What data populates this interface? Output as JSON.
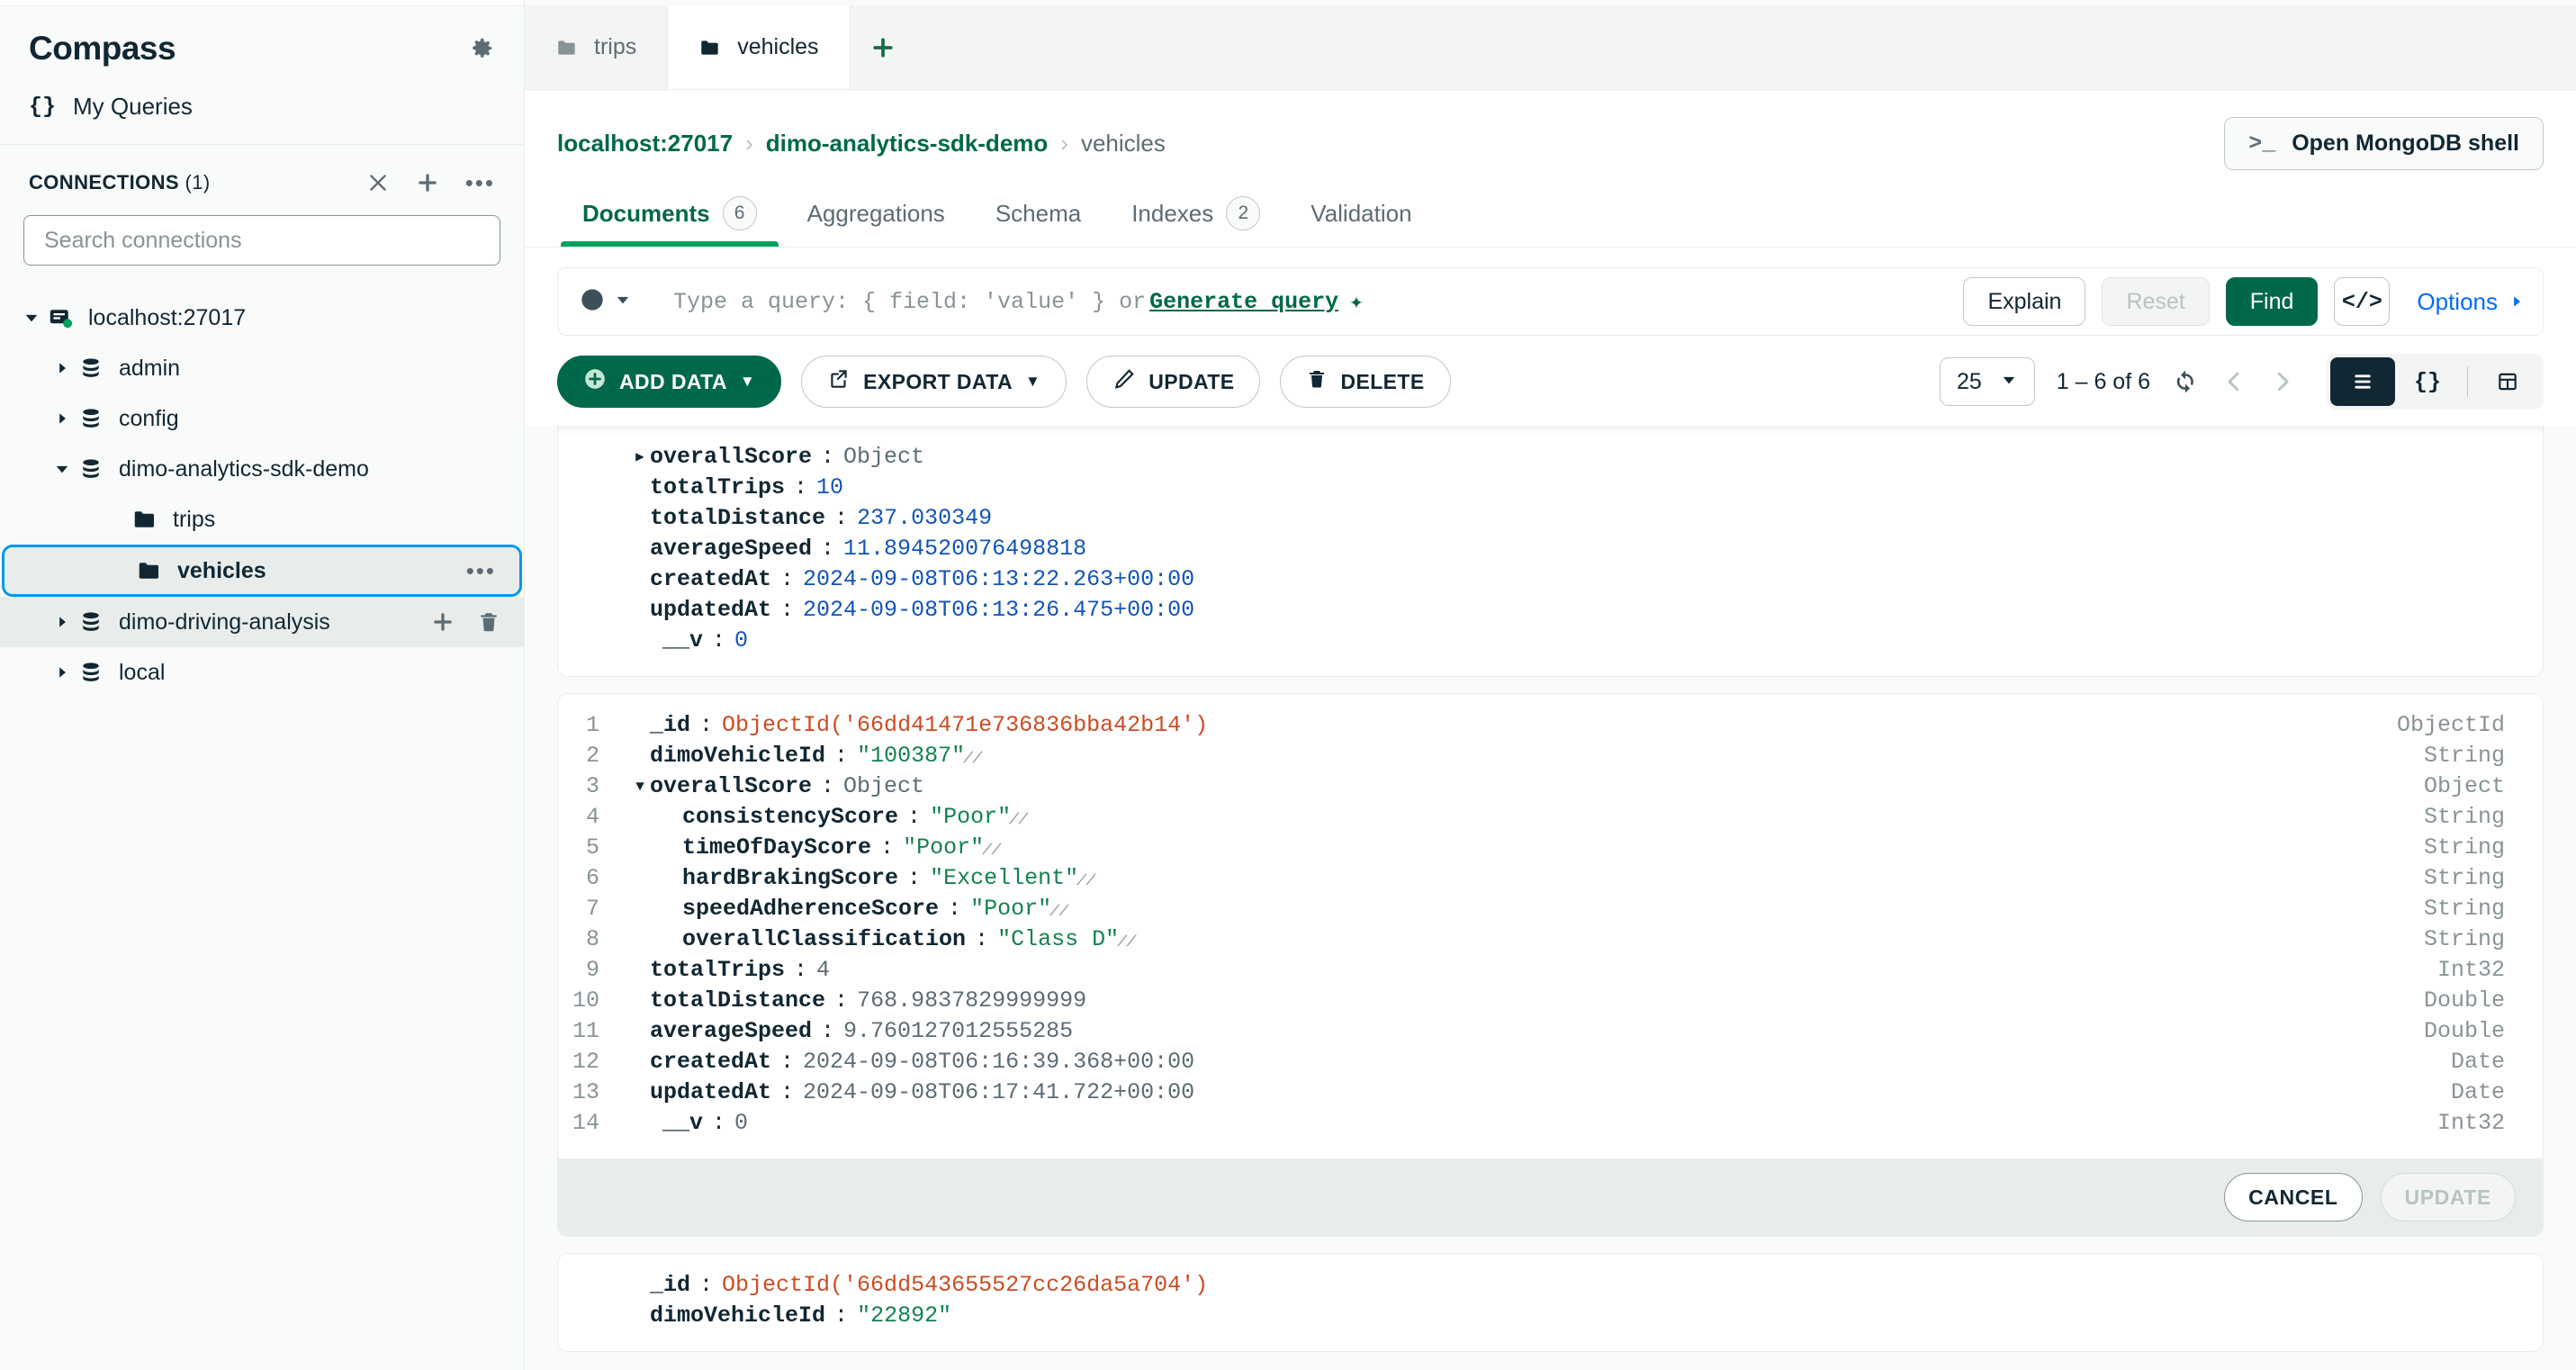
{
  "sidebar": {
    "title": "Compass",
    "gear_icon": "gear-icon",
    "my_queries": {
      "label": "My Queries",
      "icon": "braces-icon"
    },
    "connections": {
      "title": "CONNECTIONS",
      "count": "(1)",
      "actions": [
        "collapse-all-icon",
        "add-connection-icon",
        "more-options-icon"
      ]
    },
    "search": {
      "placeholder": "Search connections",
      "value": ""
    },
    "tree": [
      {
        "label": "localhost:27017",
        "level": 0,
        "icon": "server-icon",
        "expanded": true,
        "status": "connected"
      },
      {
        "label": "admin",
        "level": 1,
        "icon": "database-icon",
        "expanded": false
      },
      {
        "label": "config",
        "level": 1,
        "icon": "database-icon",
        "expanded": false
      },
      {
        "label": "dimo-analytics-sdk-demo",
        "level": 1,
        "icon": "database-icon",
        "expanded": true
      },
      {
        "label": "trips",
        "level": 2,
        "icon": "collection-icon"
      },
      {
        "label": "vehicles",
        "level": 2,
        "icon": "collection-icon",
        "selected": true,
        "actions": [
          "more-options-icon"
        ]
      },
      {
        "label": "dimo-driving-analysis",
        "level": 1,
        "icon": "database-icon",
        "expanded": false,
        "hovered": true,
        "actions": [
          "create-collection-icon",
          "drop-database-icon"
        ]
      },
      {
        "label": "local",
        "level": 1,
        "icon": "database-icon",
        "expanded": false
      }
    ]
  },
  "workspace_tabs": [
    {
      "label": "trips",
      "icon": "collection-icon",
      "active": false
    },
    {
      "label": "vehicles",
      "icon": "collection-icon",
      "active": true
    }
  ],
  "new_tab_label": "+",
  "breadcrumb": {
    "items": [
      "localhost:27017",
      "dimo-analytics-sdk-demo",
      "vehicles"
    ],
    "separator": "›"
  },
  "shell_button": {
    "label": "Open MongoDB shell",
    "icon": "terminal-icon"
  },
  "nav_tabs": [
    {
      "label": "Documents",
      "badge": "6",
      "active": true
    },
    {
      "label": "Aggregations",
      "badge": null,
      "active": false
    },
    {
      "label": "Schema",
      "badge": null,
      "active": false
    },
    {
      "label": "Indexes",
      "badge": "2",
      "active": false
    },
    {
      "label": "Validation",
      "badge": null,
      "active": false
    }
  ],
  "query_bar": {
    "history_icon": "clock-history-icon",
    "placeholder_prefix": "Type a query: { field: 'value' } or",
    "generate_query_label": "Generate query",
    "sparkle_icon": "sparkle-icon",
    "explain_label": "Explain",
    "reset_label": "Reset",
    "find_label": "Find",
    "code_icon": "code-brackets-icon",
    "options_label": "Options",
    "options_caret": "▶"
  },
  "toolbar": {
    "add_data_label": "ADD DATA",
    "export_data_label": "EXPORT DATA",
    "update_label": "UPDATE",
    "delete_label": "DELETE",
    "page_size": "25",
    "range_text": "1 – 6 of 6",
    "refresh_icon": "refresh-icon",
    "prev_icon": "chevron-left-icon",
    "next_icon": "chevron-right-icon",
    "view_list_icon": "list-view-icon",
    "view_json_icon": "json-view-icon",
    "view_table_icon": "table-view-icon"
  },
  "documents": [
    {
      "id": "doc-partial-top",
      "clipped": true,
      "fields": [
        {
          "key": "overallScore",
          "value": "Object",
          "kind": "object",
          "twisty": "collapsed",
          "indent": 0
        },
        {
          "key": "totalTrips",
          "value": "10",
          "kind": "number",
          "indent": 0
        },
        {
          "key": "totalDistance",
          "value": "237.030349",
          "kind": "number",
          "indent": 0
        },
        {
          "key": "averageSpeed",
          "value": "11.894520076498818",
          "kind": "number",
          "indent": 0
        },
        {
          "key": "createdAt",
          "value": "2024-09-08T06:13:22.263+00:00",
          "kind": "date",
          "indent": 0
        },
        {
          "key": "updatedAt",
          "value": "2024-09-08T06:13:26.475+00:00",
          "kind": "date",
          "indent": 0
        },
        {
          "key": "__v",
          "value": "0",
          "kind": "number",
          "indent": 0
        }
      ]
    },
    {
      "id": "doc-editing",
      "editing": true,
      "cancel_label": "CANCEL",
      "update_label": "UPDATE",
      "fields": [
        {
          "line": "1",
          "key": "_id",
          "value": "ObjectId('66dd41471e736836bba42b14')",
          "kind": "objectid",
          "type": "ObjectId",
          "indent": 0
        },
        {
          "line": "2",
          "key": "dimoVehicleId",
          "value": "\"100387\"",
          "kind": "string",
          "type": "String",
          "indent": 0,
          "edited": true
        },
        {
          "line": "3",
          "key": "overallScore",
          "value": "Object",
          "kind": "object",
          "type": "Object",
          "twisty": "expanded",
          "indent": 0
        },
        {
          "line": "4",
          "key": "consistencyScore",
          "value": "\"Poor\"",
          "kind": "string",
          "type": "String",
          "indent": 1,
          "edited": true
        },
        {
          "line": "5",
          "key": "timeOfDayScore",
          "value": "\"Poor\"",
          "kind": "string",
          "type": "String",
          "indent": 1,
          "edited": true
        },
        {
          "line": "6",
          "key": "hardBrakingScore",
          "value": "\"Excellent\"",
          "kind": "string",
          "type": "String",
          "indent": 1,
          "edited": true
        },
        {
          "line": "7",
          "key": "speedAdherenceScore",
          "value": "\"Poor\"",
          "kind": "string",
          "type": "String",
          "indent": 1,
          "edited": true
        },
        {
          "line": "8",
          "key": "overallClassification",
          "value": "\"Class D\"",
          "kind": "string",
          "type": "String",
          "indent": 1,
          "edited": true
        },
        {
          "line": "9",
          "key": "totalTrips",
          "value": "4",
          "kind": "plain",
          "type": "Int32",
          "indent": 0
        },
        {
          "line": "10",
          "key": "totalDistance",
          "value": "768.9837829999999",
          "kind": "plain",
          "type": "Double",
          "indent": 0
        },
        {
          "line": "11",
          "key": "averageSpeed",
          "value": "9.760127012555285",
          "kind": "plain",
          "type": "Double",
          "indent": 0
        },
        {
          "line": "12",
          "key": "createdAt",
          "value": "2024-09-08T06:16:39.368+00:00",
          "kind": "plain",
          "type": "Date",
          "indent": 0
        },
        {
          "line": "13",
          "key": "updatedAt",
          "value": "2024-09-08T06:17:41.722+00:00",
          "kind": "plain",
          "type": "Date",
          "indent": 0
        },
        {
          "line": "14",
          "key": "__v",
          "value": "0",
          "kind": "plain",
          "type": "Int32",
          "indent": 0
        }
      ]
    },
    {
      "id": "doc-partial-bottom",
      "clipped_bottom": true,
      "fields": [
        {
          "key": "_id",
          "value": "ObjectId('66dd543655527cc26da5a704')",
          "kind": "objectid",
          "indent": 0
        },
        {
          "key": "dimoVehicleId",
          "value": "\"22892\"",
          "kind": "string",
          "indent": 0
        }
      ]
    }
  ],
  "colors": {
    "brand_green": "#00684a",
    "accent_green": "#00a35c",
    "selection_blue": "#0498ec",
    "link_blue": "#016bf8",
    "string_green": "#12824d",
    "number_blue": "#1254b7",
    "objectid_red": "#cf4a22",
    "text_dark": "#112733",
    "text_muted": "#5c6c75"
  }
}
